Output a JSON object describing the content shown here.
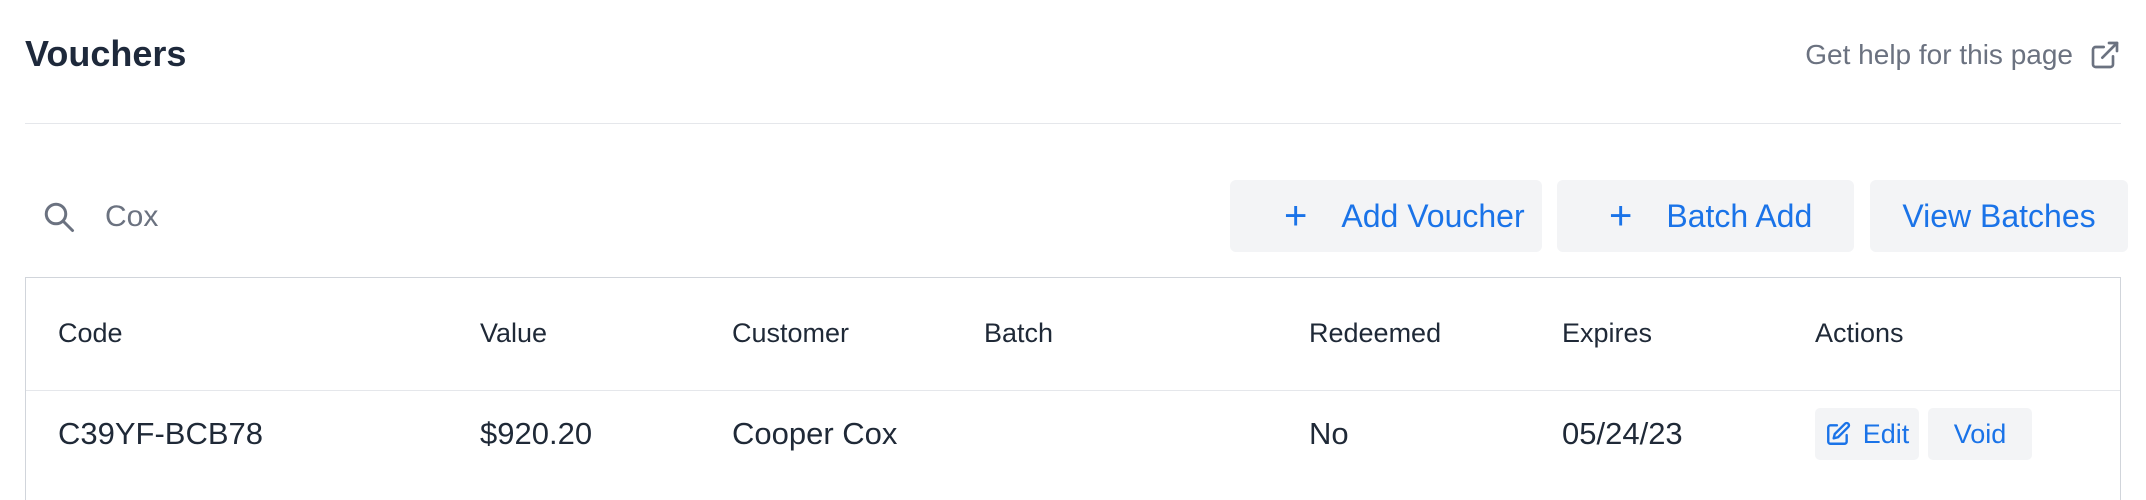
{
  "page": {
    "title": "Vouchers",
    "help_label": "Get help for this page",
    "help_icon": "external-link-icon"
  },
  "toolbar": {
    "search": {
      "value": "Cox",
      "icon": "search-icon"
    },
    "add_voucher_label": "Add Voucher",
    "batch_add_label": "Batch Add",
    "view_batches_label": "View Batches",
    "plus_glyph": "+"
  },
  "table": {
    "columns": [
      "Code",
      "Value",
      "Customer",
      "Batch",
      "Redeemed",
      "Expires",
      "Actions"
    ],
    "rows": [
      {
        "code": "C39YF-BCB78",
        "value": "$920.20",
        "customer": "Cooper Cox",
        "batch": "",
        "redeemed": "No",
        "expires": "05/24/23",
        "edit_label": "Edit",
        "void_label": "Void"
      }
    ]
  },
  "colors": {
    "accent": "#1a73e8",
    "button_bg": "#f3f4f6",
    "muted_text": "#6b7280"
  }
}
